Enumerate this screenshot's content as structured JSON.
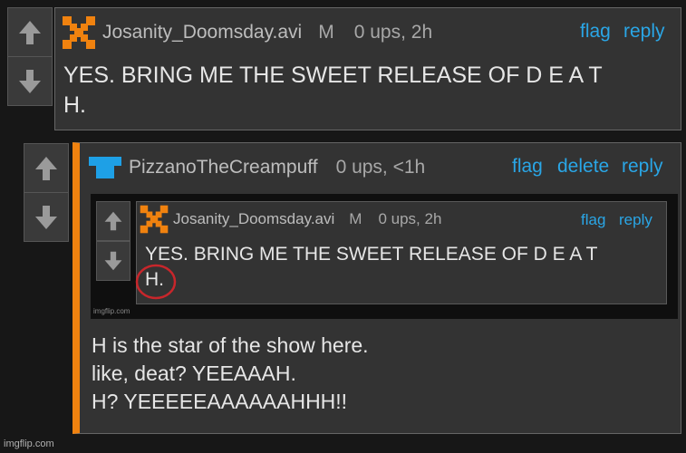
{
  "comment1": {
    "username": "Josanity_Doomsday.avi",
    "badge": "M",
    "stats": "0 ups, 2h",
    "actions": {
      "flag": "flag",
      "reply": "reply"
    },
    "text_line1": "YES. BRING ME THE SWEET RELEASE OF D E A T",
    "text_line2": "H."
  },
  "comment2": {
    "username": "PizzanoTheCreampuff",
    "stats": "0 ups, <1h",
    "actions": {
      "flag": "flag",
      "delete": "delete",
      "reply": "reply"
    },
    "embedded_image": {
      "username": "Josanity_Doomsday.avi",
      "badge": "M",
      "stats": "0 ups, 2h",
      "actions": {
        "flag": "flag",
        "reply": "reply"
      },
      "text_line1": "YES. BRING ME THE SWEET RELEASE OF D E A T",
      "text_line2": "H.",
      "watermark": "imgflip.com"
    },
    "text_lines": [
      "H is the star of the show here.",
      "like, deat? YEEAAAH.",
      "H? YEEEEEAAAAAAHHH!!"
    ]
  },
  "watermark": "imgflip.com",
  "colors": {
    "accent_orange": "#f0820f",
    "link_blue": "#2aa6e6",
    "avatar_blue": "#1ea0e6",
    "circle_red": "#c8262b"
  }
}
